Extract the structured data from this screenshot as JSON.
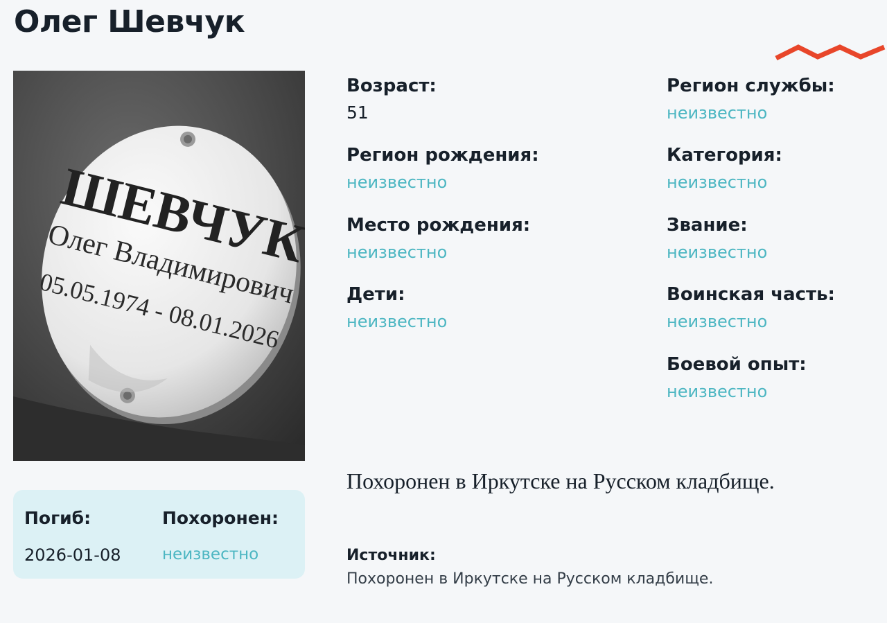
{
  "person": {
    "name": "Олег Шевчук"
  },
  "photo": {
    "plaque_surname": "ШЕВЧУК",
    "plaque_name": "Олег Владимирович",
    "plaque_dates": "05.05.1974 - 08.01.2026"
  },
  "death_card": {
    "died_label": "Погиб:",
    "died_value": "2026-01-08",
    "buried_label": "Похоронен:",
    "buried_value": "неизвестно"
  },
  "details_left": [
    {
      "label": "Возраст:",
      "value": "51"
    },
    {
      "label": "Регион рождения:",
      "value": "неизвестно"
    },
    {
      "label": "Место рождения:",
      "value": "неизвестно"
    },
    {
      "label": "Дети:",
      "value": "неизвестно"
    }
  ],
  "details_right": [
    {
      "label": "Регион службы:",
      "value": "неизвестно"
    },
    {
      "label": "Категория:",
      "value": "неизвестно"
    },
    {
      "label": "Звание:",
      "value": "неизвестно"
    },
    {
      "label": "Воинская часть:",
      "value": "неизвестно"
    },
    {
      "label": "Боевой опыт:",
      "value": "неизвестно"
    }
  ],
  "description": "Похоронен в Иркутске на Русском кладбище.",
  "source": {
    "label": "Источник:",
    "value": "Похоронен в Иркутске на Русском кладбище."
  },
  "colors": {
    "background": "#f5f7f9",
    "text": "#17202a",
    "unknown_value": "#4cb6c2",
    "death_card_bg": "#dcf1f5",
    "accent_zigzag": "#e8462a"
  }
}
